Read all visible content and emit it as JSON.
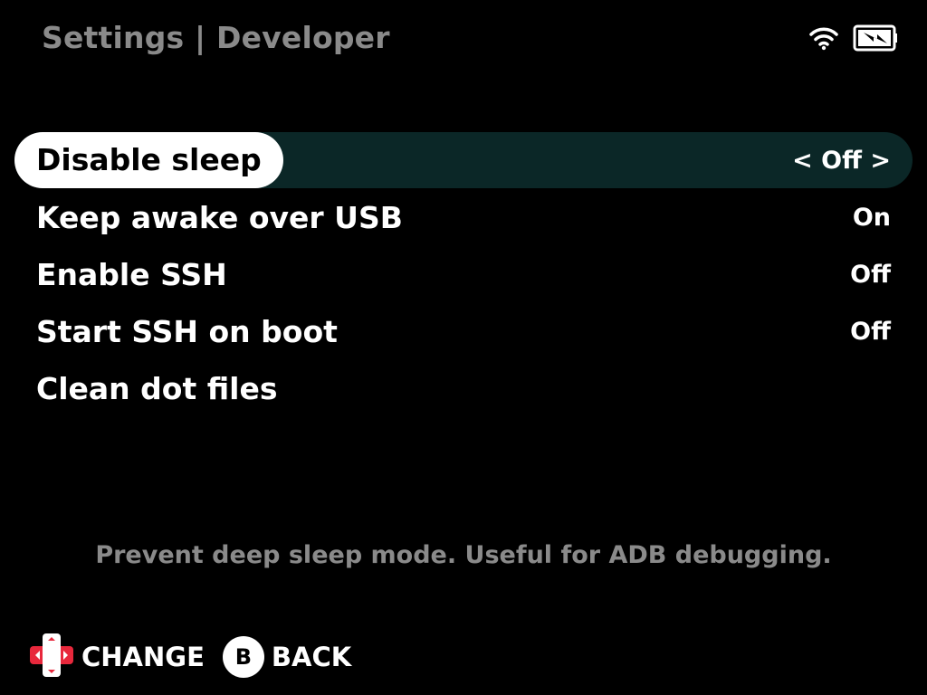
{
  "header": {
    "title": "Settings | Developer",
    "wifi_icon": "wifi-icon",
    "battery_icon": "battery-charging-icon"
  },
  "menu": {
    "items": [
      {
        "label": "Disable sleep",
        "value": "< Off >",
        "selected": true
      },
      {
        "label": "Keep awake over USB",
        "value": "On",
        "selected": false
      },
      {
        "label": "Enable SSH",
        "value": "Off",
        "selected": false
      },
      {
        "label": "Start SSH on boot",
        "value": "Off",
        "selected": false
      },
      {
        "label": "Clean dot files",
        "value": "",
        "selected": false
      }
    ]
  },
  "hint": "Prevent deep sleep mode. Useful for ADB debugging.",
  "footer": {
    "change_label": "CHANGE",
    "change_icon": "dpad-icon",
    "back_button": "B",
    "back_label": "BACK"
  },
  "colors": {
    "background": "#000000",
    "title_gray": "#8a8a8a",
    "selected_row_bg": "#0b2727",
    "pill_bg": "#ffffff",
    "dpad_red": "#e8283c"
  }
}
